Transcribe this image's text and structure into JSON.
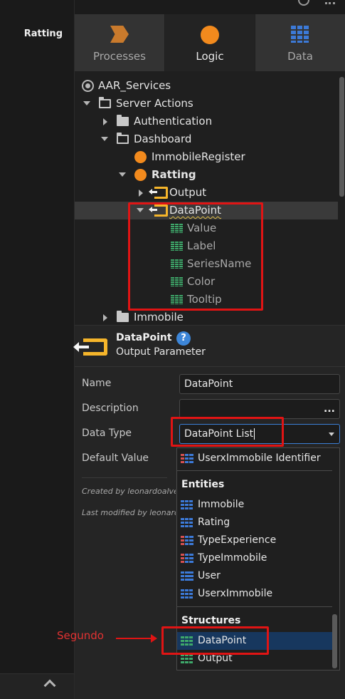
{
  "sidebar": {
    "title": "Ratting"
  },
  "tabs": [
    {
      "label": "Processes",
      "icon": "process-icon",
      "active": false
    },
    {
      "label": "Logic",
      "icon": "logic-icon",
      "active": true
    },
    {
      "label": "Data",
      "icon": "data-icon",
      "active": false
    }
  ],
  "tree": {
    "root": "AAR_Services",
    "server_actions": "Server Actions",
    "authentication": "Authentication",
    "dashboard": "Dashboard",
    "immobile_register": "ImmobileRegister",
    "ratting": "Ratting",
    "output": "Output",
    "datapoint": "DataPoint",
    "attributes": [
      "Value",
      "Label",
      "SeriesName",
      "Color",
      "Tooltip"
    ],
    "immobile": "Immobile"
  },
  "properties": {
    "name": "DataPoint",
    "help": "?",
    "subtitle": "Output Parameter",
    "name_label": "Name",
    "name_value": "DataPoint",
    "description_label": "Description",
    "description_button": "...",
    "data_type_label": "Data Type",
    "data_type_value": "DataPoint List",
    "default_value_label": "Default Value",
    "created_by": "Created by leonardoalves",
    "modified_by": "Last modified by leonardoalves"
  },
  "dropdown": {
    "top_item": "UserxImmobile Identifier",
    "entities_header": "Entities",
    "entities": [
      "Immobile",
      "Rating",
      "TypeExperience",
      "TypeImmobile",
      "User",
      "UserxImmobile"
    ],
    "structures_header": "Structures",
    "structures": [
      "DataPoint",
      "Output"
    ],
    "selected": "DataPoint"
  },
  "annotation": {
    "text": "Segundo",
    "color": "#e01414"
  },
  "colors": {
    "accent": "#3c7fd6",
    "logic": "#f28a1d",
    "output_icon": "#f5b52b",
    "structure_icon": "#3ea86a",
    "entity_icon": "#3c7ad8"
  }
}
